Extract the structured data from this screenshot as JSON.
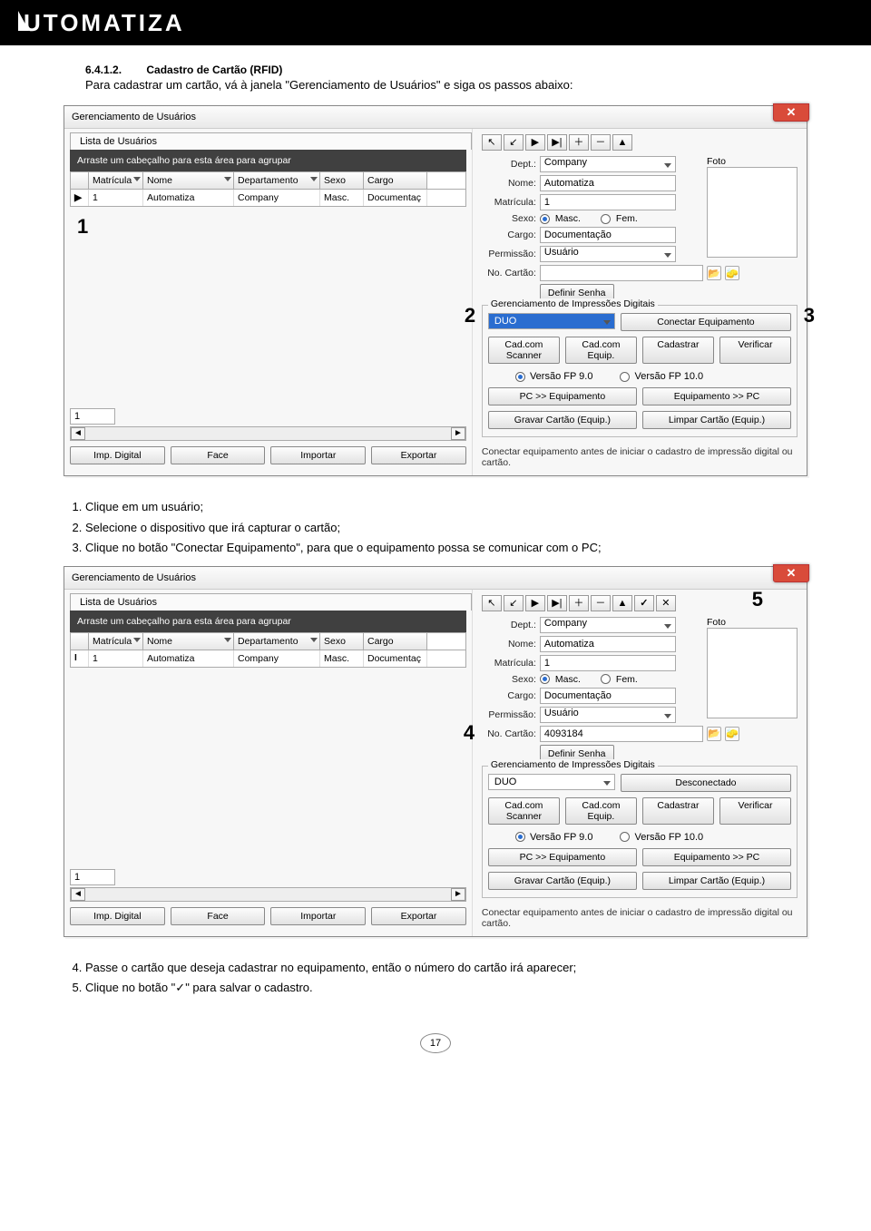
{
  "logo": "UTOMATIZA",
  "section": {
    "num": "6.4.1.2.",
    "title": "Cadastro de Cartão (RFID)"
  },
  "intro": "Para cadastrar um cartão, vá à janela \"Gerenciamento de Usuários\" e siga os passos abaixo:",
  "instructions_a": {
    "i1": "Clique em um usuário;",
    "i2": "Selecione o dispositivo que irá capturar o cartão;",
    "i3": "Clique no botão \"Conectar Equipamento\", para que o equipamento possa se comunicar com o PC;"
  },
  "instructions_b": {
    "i4": "Passe o cartão que deseja cadastrar no equipamento, então o número do cartão irá aparecer;",
    "i5": "Clique no botão \"✓\" para salvar o cadastro."
  },
  "win": {
    "title": "Gerenciamento de Usuários",
    "tab": "Lista de Usuários",
    "group_hint": "Arraste um cabeçalho para esta área para agrupar",
    "cols": {
      "matricula": "Matrícula",
      "nome": "Nome",
      "dept": "Departamento",
      "sexo": "Sexo",
      "cargo": "Cargo"
    },
    "row": {
      "matricula": "1",
      "nome": "Automatiza",
      "dept": "Company",
      "sexo": "Masc.",
      "cargo": "Documentaç"
    },
    "page_val": "1",
    "bottom_btns": {
      "imp": "Imp. Digital",
      "face": "Face",
      "importar": "Importar",
      "exportar": "Exportar"
    },
    "form": {
      "dept_lbl": "Dept.:",
      "dept_val": "Company",
      "nome_lbl": "Nome:",
      "nome_val": "Automatiza",
      "matric_lbl": "Matrícula:",
      "matric_val": "1",
      "sexo_lbl": "Sexo:",
      "masc": "Masc.",
      "fem": "Fem.",
      "cargo_lbl": "Cargo:",
      "cargo_val": "Documentação",
      "perm_lbl": "Permissão:",
      "perm_val": "Usuário",
      "cartao_lbl": "No. Cartão:",
      "cartao_val_b": "4093184",
      "definir": "Definir Senha",
      "foto": "Foto"
    },
    "nav": {
      "n1": "↖",
      "n2": "↙",
      "n3": "▶",
      "n4": "▶|",
      "n5": "＋",
      "n6": "－",
      "n7": "▲",
      "n8": "✓",
      "n9": "✕"
    },
    "fp": {
      "legend": "Gerenciamento de Impressões Digitais",
      "duo": "DUO",
      "conectar": "Conectar Equipamento",
      "desconectado": "Desconectado",
      "cad_scanner": "Cad.com Scanner",
      "cad_equip": "Cad.com Equip.",
      "cadastrar": "Cadastrar",
      "verificar": "Verificar",
      "v9": "Versão FP 9.0",
      "v10": "Versão FP 10.0",
      "pc_eq": "PC >> Equipamento",
      "eq_pc": "Equipamento >> PC",
      "gravar": "Gravar Cartão (Equip.)",
      "limpar": "Limpar Cartão (Equip.)"
    },
    "status": "Conectar equipamento antes de iniciar o cadastro de impressão digital ou cartão."
  },
  "callouts": {
    "c1": "1",
    "c2": "2",
    "c3": "3",
    "c4": "4",
    "c5": "5"
  },
  "page_num": "17"
}
